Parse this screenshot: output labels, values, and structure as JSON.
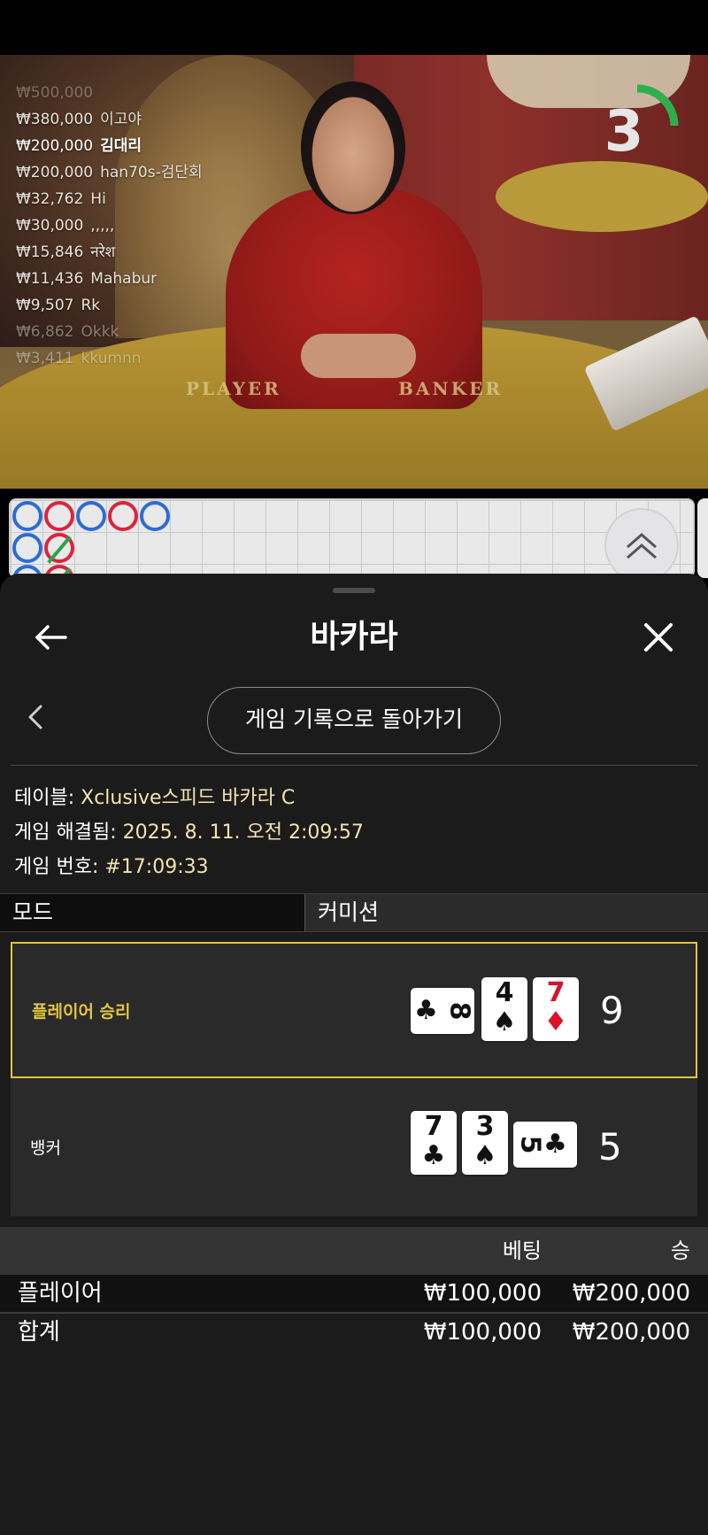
{
  "stream": {
    "winners": [
      {
        "amount": "₩380,000",
        "name": "이고야"
      },
      {
        "amount": "₩200,000",
        "name": "김대리"
      },
      {
        "amount": "₩200,000",
        "name": "han70s-검단회"
      },
      {
        "amount": "₩32,762",
        "name": "Hi"
      },
      {
        "amount": "₩30,000",
        "name": ",,,,,"
      },
      {
        "amount": "₩15,846",
        "name": "नरेश"
      },
      {
        "amount": "₩11,436",
        "name": "Mahabur"
      },
      {
        "amount": "₩9,507",
        "name": "Rk"
      },
      {
        "amount": "₩6,862",
        "name": "Okkk"
      },
      {
        "amount": "₩3,411",
        "name": "kkumnn"
      }
    ],
    "top_partial": "₩500,000",
    "timer": "3",
    "felt_player": "PLAYER",
    "felt_banker": "BANKER"
  },
  "sheet": {
    "title": "바카라",
    "back_to_history": "게임 기록으로 돌아가기",
    "info": {
      "table_label": "테이블: ",
      "table_value": "Xclusive스피드 바카라 C",
      "resolved_label": "게임 해결됨: ",
      "resolved_value": "2025. 8. 11. 오전 2:09:57",
      "game_no_label": "게임 번호: ",
      "game_no_value": "#17:09:33"
    },
    "tabs": {
      "mode": "모드",
      "commission": "커미션"
    },
    "results": {
      "player_label": "플레이어 승리",
      "player_score": "9",
      "banker_label": "뱅커",
      "banker_score": "5"
    },
    "bets": {
      "header_bet": "베팅",
      "header_win": "승",
      "rows": [
        {
          "label": "플레이어",
          "bet": "₩100,000",
          "win": "₩200,000"
        },
        {
          "label": "합계",
          "bet": "₩100,000",
          "win": "₩200,000"
        }
      ]
    }
  },
  "cards": {
    "player": [
      {
        "rank": "8",
        "suit": "♣",
        "color": "black",
        "orientation": "side"
      },
      {
        "rank": "4",
        "suit": "♠",
        "color": "black",
        "orientation": "upright"
      },
      {
        "rank": "7",
        "suit": "♦",
        "color": "red",
        "orientation": "upright"
      }
    ],
    "banker": [
      {
        "rank": "7",
        "suit": "♣",
        "color": "black",
        "orientation": "upright"
      },
      {
        "rank": "3",
        "suit": "♠",
        "color": "black",
        "orientation": "upright"
      },
      {
        "rank": "5",
        "suit": "♣",
        "color": "black",
        "orientation": "side"
      }
    ]
  },
  "colors": {
    "accent": "#e2c640",
    "info_value": "#f3e3b0",
    "bead_blue": "#2d6cd2",
    "bead_red": "#d7263d",
    "timer_ring": "#2fae4e"
  }
}
